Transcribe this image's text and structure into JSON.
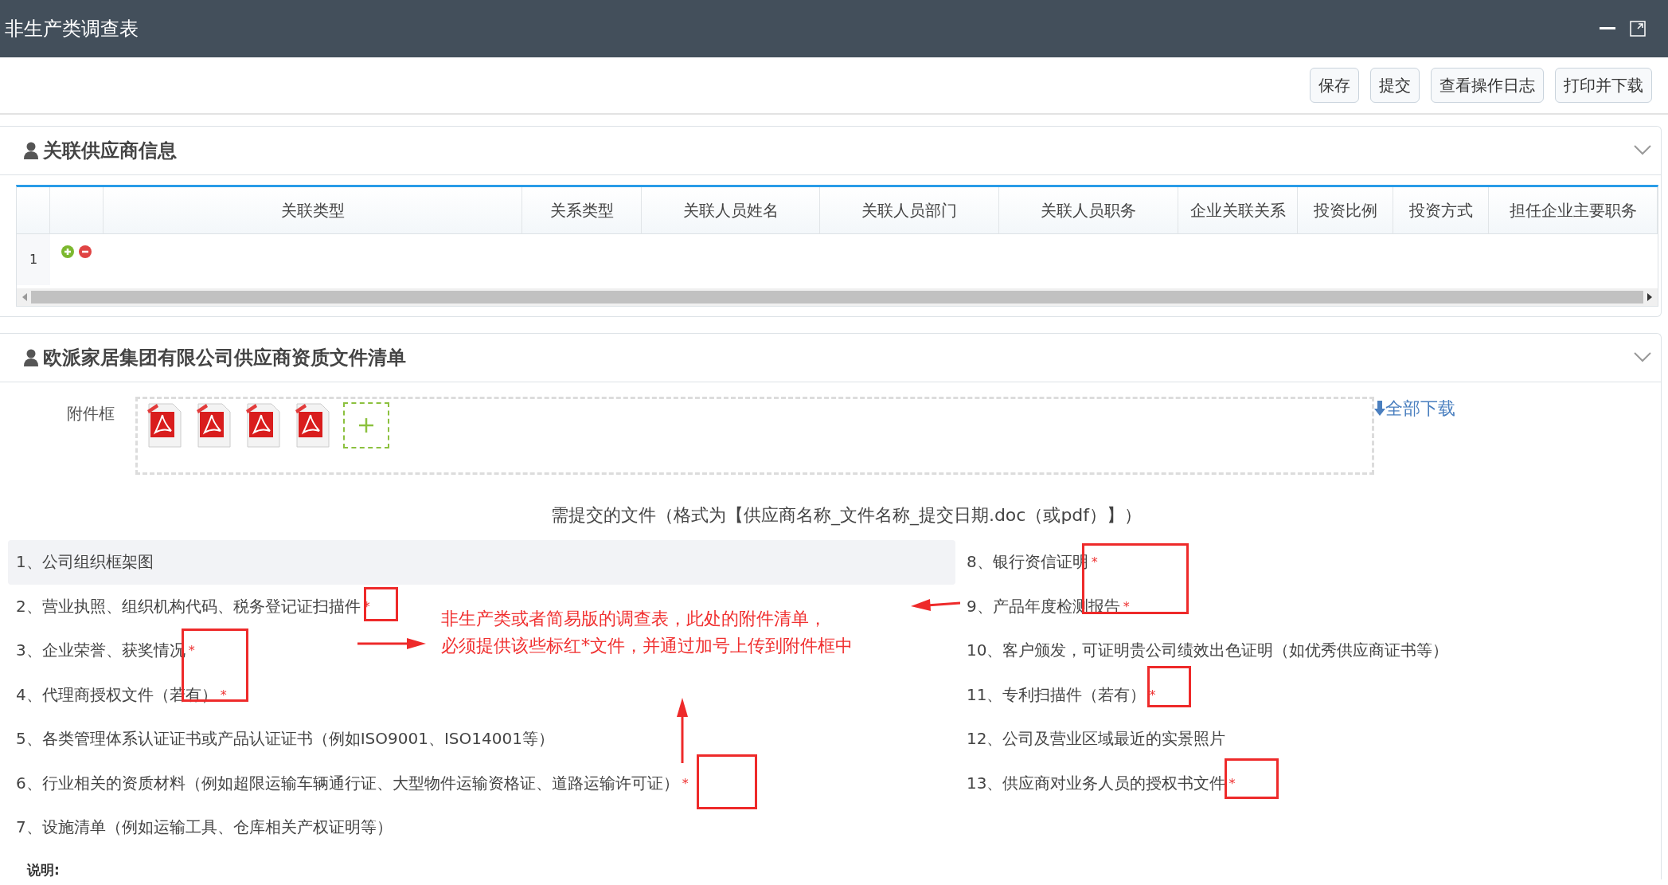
{
  "window": {
    "title": "非生产类调查表"
  },
  "toolbar": {
    "buttons": [
      "保存",
      "提交",
      "查看操作日志",
      "打印并下载"
    ]
  },
  "supplier_section": {
    "title": "关联供应商信息",
    "expanded": true,
    "table": {
      "columns": [
        "关联类型",
        "关系类型",
        "关联人员姓名",
        "关联人员部门",
        "关联人员职务",
        "企业关联关系",
        "投资比例",
        "投资方式",
        "担任企业主要职务"
      ],
      "rows": [
        {
          "number": "1"
        }
      ]
    }
  },
  "documents_section": {
    "title": "欧派家居集团有限公司供应商资质文件清单",
    "expanded": true,
    "attachment_label": "附件框",
    "files": [
      {
        "kind": "pdf"
      },
      {
        "kind": "pdf"
      },
      {
        "kind": "pdf"
      },
      {
        "kind": "pdf"
      }
    ],
    "download_all": "全部下载",
    "heading": "需提交的文件（格式为【供应商名称_文件名称_提交日期.doc（或pdf）】）",
    "left_items": [
      {
        "text": "1、公司组织框架图",
        "required": false,
        "highlighted": true
      },
      {
        "text": "2、营业执照、组织机构代码、税务登记证扫描件",
        "required": true,
        "highlighted": false
      },
      {
        "text": "3、企业荣誉、获奖情况",
        "required": true,
        "highlighted": false
      },
      {
        "text": "4、代理商授权文件（若有）",
        "required": true,
        "highlighted": false
      },
      {
        "text": "5、各类管理体系认证证书或产品认证证书（例如ISO9001、ISO14001等）",
        "required": false,
        "highlighted": false
      },
      {
        "text": "6、行业相关的资质材料（例如超限运输车辆通行证、大型物件运输资格证、道路运输许可证）",
        "required": true,
        "highlighted": false
      },
      {
        "text": "7、设施清单（例如运输工具、仓库相关产权证明等）",
        "required": false,
        "highlighted": false
      }
    ],
    "right_items": [
      {
        "text": "8、银行资信证明",
        "required": true,
        "highlighted": false
      },
      {
        "text": "9、产品年度检测报告",
        "required": true,
        "highlighted": false
      },
      {
        "text": "10、客户颁发，可证明贵公司绩效出色证明（如优秀供应商证书等）",
        "required": false,
        "highlighted": false
      },
      {
        "text": "11、专利扫描件（若有）",
        "required": true,
        "highlighted": false
      },
      {
        "text": "12、公司及营业区域最近的实景照片",
        "required": false,
        "highlighted": false
      },
      {
        "text": "13、供应商对业务人员的授权书文件",
        "required": true,
        "highlighted": false
      }
    ],
    "required_mark": "*",
    "notes_label": "说明:"
  },
  "annotation": {
    "lines": [
      "非生产类或者简易版的调查表，此处的附件清单，",
      "必须提供该些标红*文件，并通过加号上传到附件框中"
    ]
  }
}
